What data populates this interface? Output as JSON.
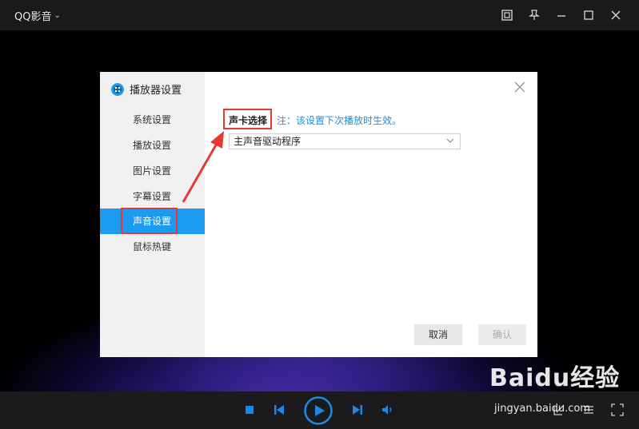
{
  "window": {
    "title": "QQ影音"
  },
  "dialog": {
    "title": "播放器设置",
    "sidebar_items": [
      {
        "label": "系统设置"
      },
      {
        "label": "播放设置"
      },
      {
        "label": "图片设置"
      },
      {
        "label": "字幕设置"
      },
      {
        "label": "声音设置",
        "active": true
      },
      {
        "label": "鼠标热键"
      }
    ],
    "sound_card_label": "声卡选择",
    "note": "注：该设置下次播放时生效。",
    "sound_card_selected": "主声音驱动程序",
    "cancel_label": "取消",
    "ok_label": "确认"
  },
  "watermark": {
    "brand": "Baidu经验",
    "url": "jingyan.baidu.com"
  },
  "colors": {
    "accent": "#1d9bf0",
    "highlight": "#e53935",
    "control_blue": "#1e88e5"
  }
}
